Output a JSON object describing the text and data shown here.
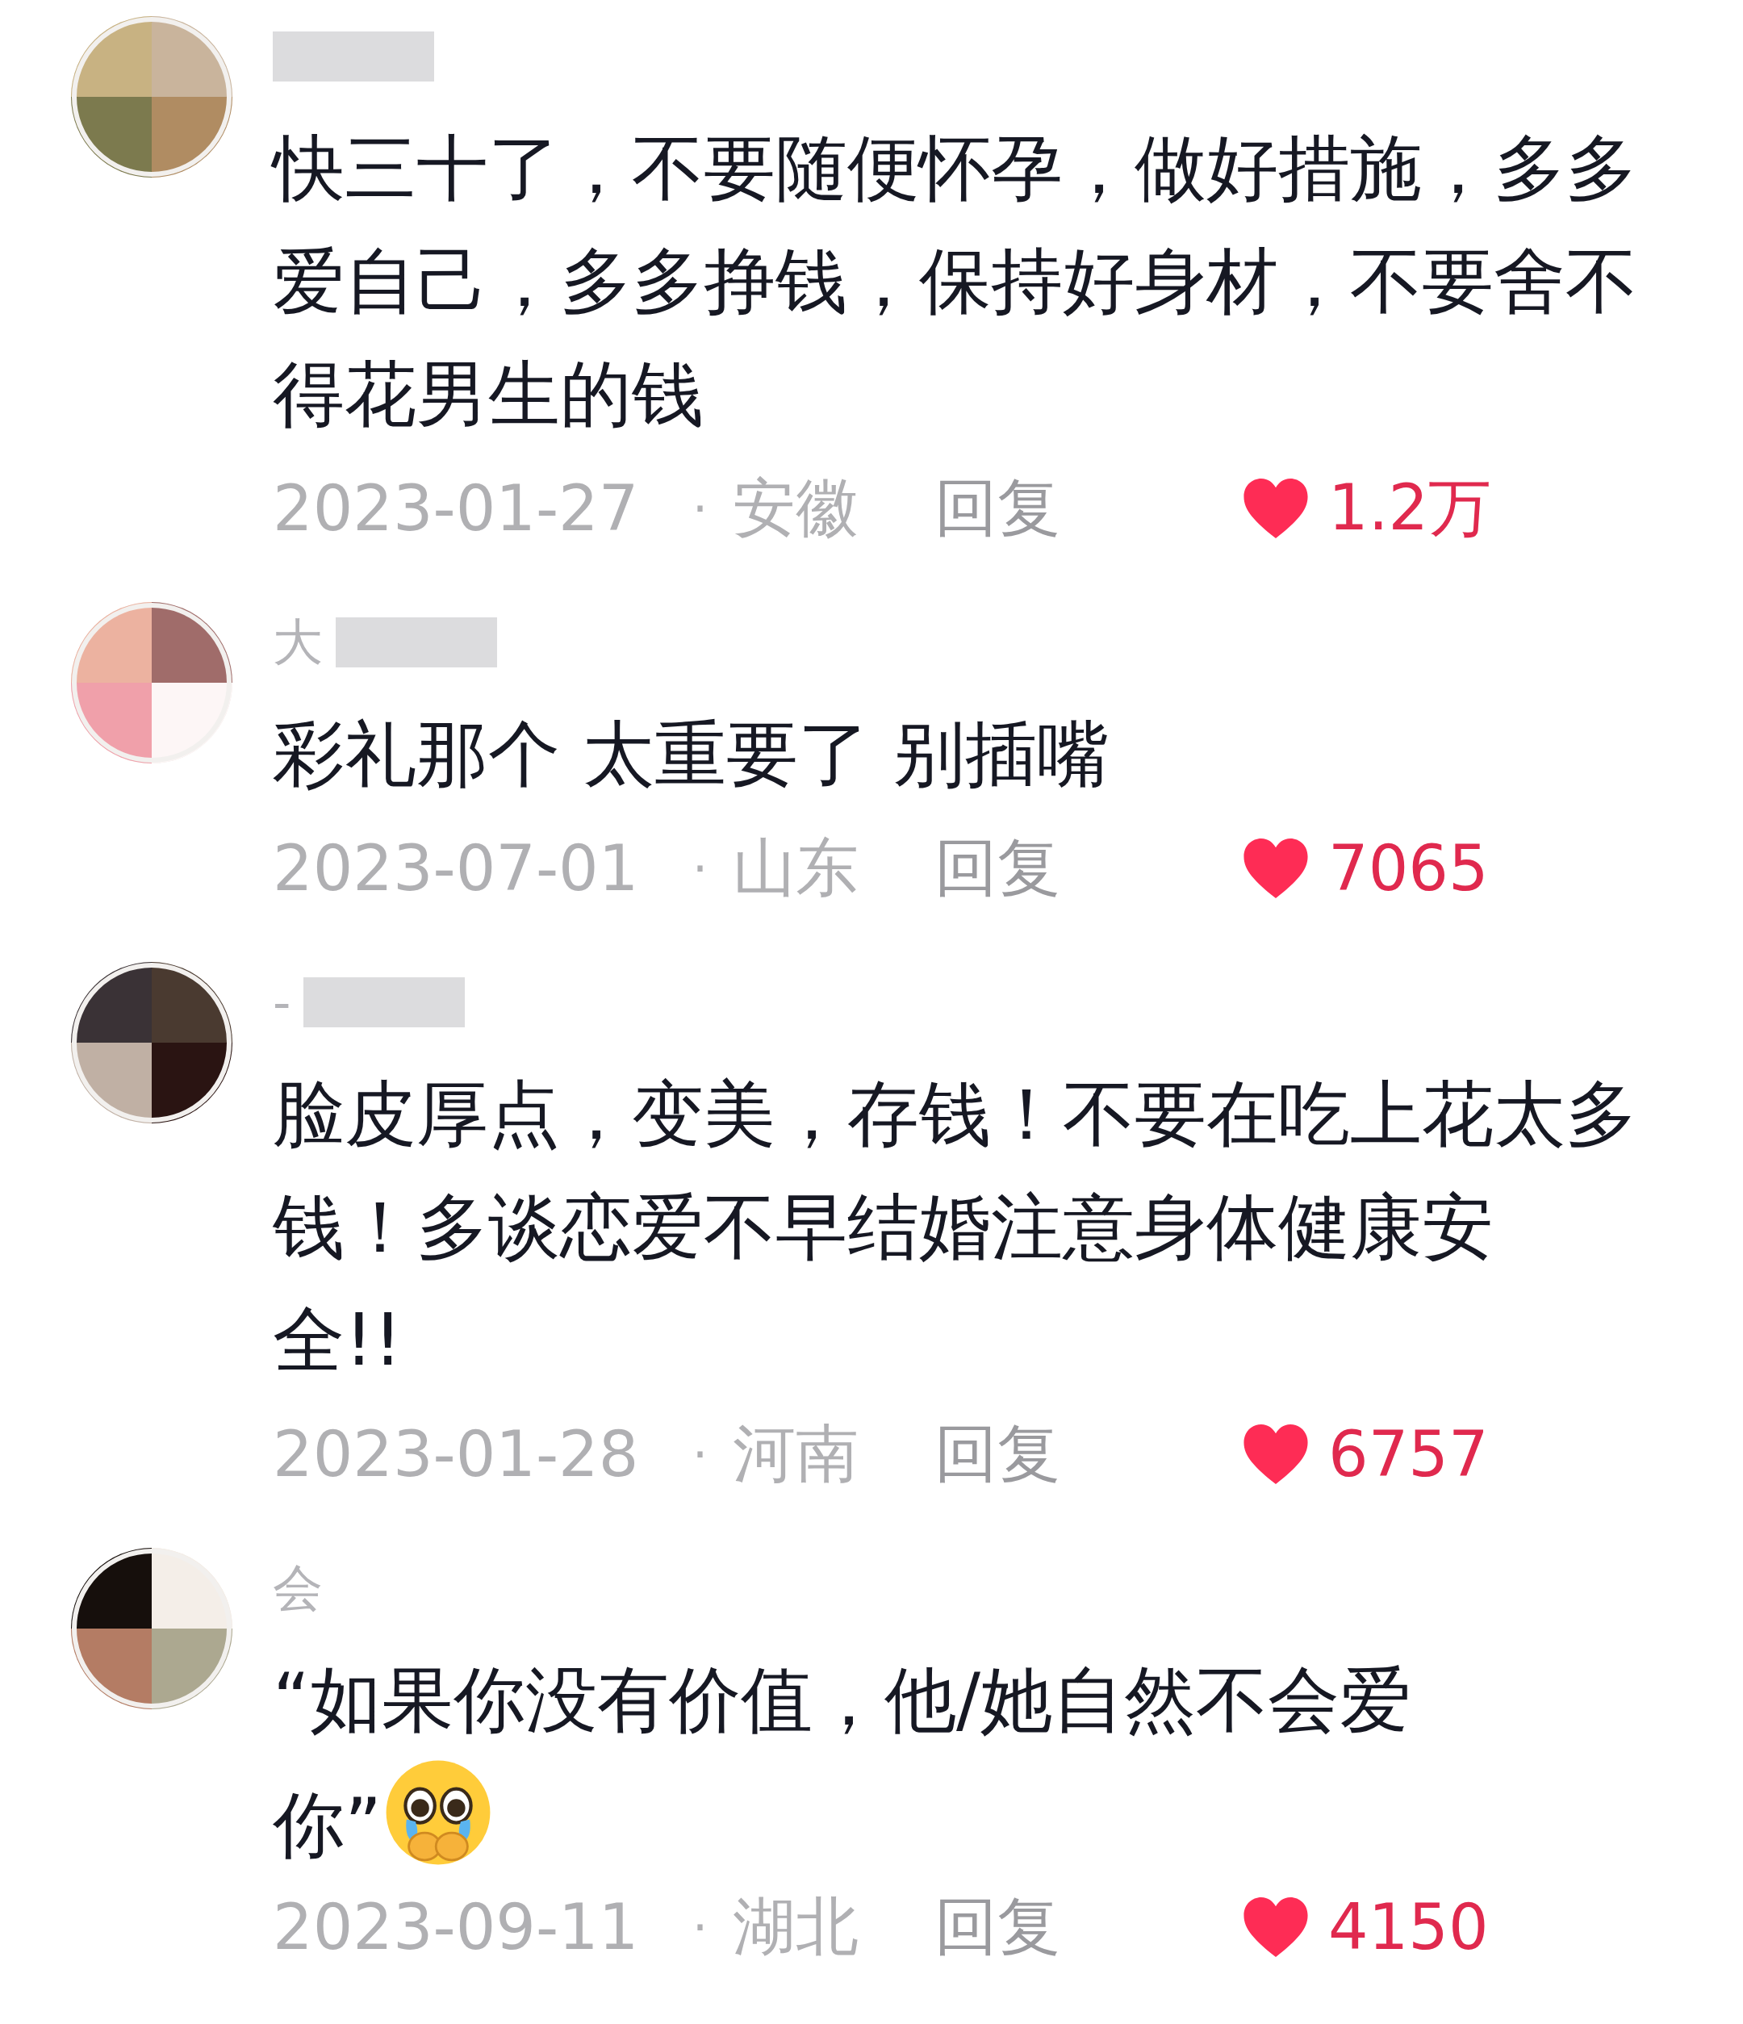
{
  "comments": [
    {
      "masked": true,
      "avatar": {
        "kind": "picture"
      },
      "lines": [
        "快三十了，不要随便怀孕，做好措施，多多",
        "爱自己，多多挣钱，保持好身材，不要舍不",
        "得花男生的钱"
      ],
      "date": "2023-01-27",
      "separator": "·",
      "region": "安徽",
      "reply": "回复",
      "likes": "1.2万"
    },
    {
      "username": "大",
      "masked": true,
      "avatar": {
        "kind": "picture"
      },
      "lines": [
        "彩礼那个 太重要了 别插嘴"
      ],
      "date": "2023-07-01",
      "separator": "·",
      "region": "山东",
      "reply": "回复",
      "likes": "7065"
    },
    {
      "username": "-",
      "masked": true,
      "avatar": {
        "kind": "picture"
      },
      "lines": [
        "脸皮厚点，变美，存钱！不要在吃上花太多",
        "钱！多谈恋爱不早结婚注意身体健康安",
        "全!!"
      ],
      "date": "2023-01-28",
      "separator": "·",
      "region": "河南",
      "reply": "回复",
      "likes": "6757"
    },
    {
      "username": "会",
      "avatar": {
        "kind": "picture"
      },
      "lines": [
        "“如果你没有价值，他/她自然不会爱",
        "你”"
      ],
      "emoji": true,
      "date": "2023-09-11",
      "separator": "·",
      "region": "湖北",
      "reply": "回复",
      "likes": "4150"
    }
  ]
}
